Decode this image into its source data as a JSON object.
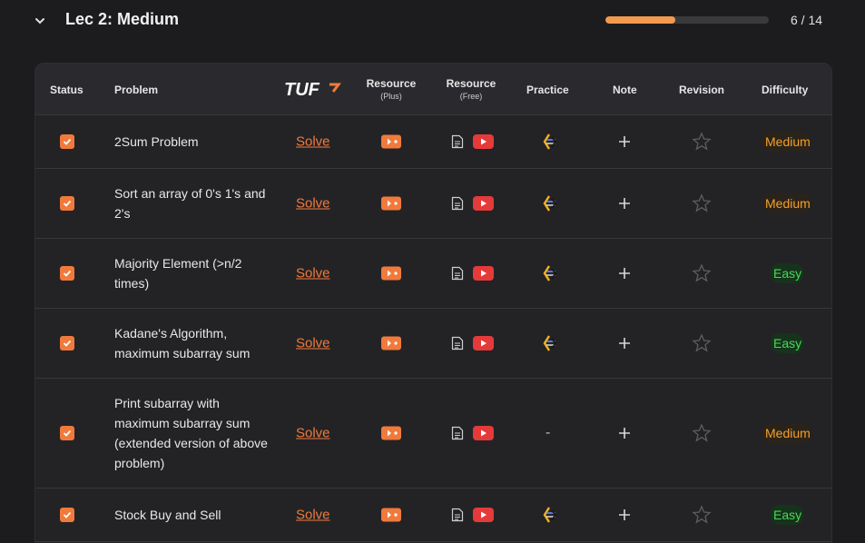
{
  "section": {
    "title": "Lec 2: Medium",
    "progress_text": "6 / 14",
    "progress_fraction": 0.43
  },
  "colors": {
    "accent": "#f07a3c",
    "background": "#1c1c1e",
    "easy": "#4ad85a",
    "medium": "#f4a02a",
    "youtube": "#e53a3a"
  },
  "table": {
    "headers": {
      "status": "Status",
      "problem": "Problem",
      "tuf_logo": "TUF",
      "resource_plus": "Resource",
      "resource_plus_sub": "(Plus)",
      "resource_free": "Resource",
      "resource_free_sub": "(Free)",
      "practice": "Practice",
      "note": "Note",
      "revision": "Revision",
      "difficulty": "Difficulty"
    },
    "rows": [
      {
        "problem": "2Sum Problem",
        "solve": "Solve",
        "practice": "codestudio-icon",
        "difficulty": "Medium",
        "checked": true
      },
      {
        "problem": "Sort an array of 0's 1's and 2's",
        "solve": "Solve",
        "practice": "codestudio-icon",
        "difficulty": "Medium",
        "checked": true
      },
      {
        "problem": "Majority Element (>n/2 times)",
        "solve": "Solve",
        "practice": "codestudio-icon",
        "difficulty": "Easy",
        "checked": true
      },
      {
        "problem": "Kadane's Algorithm, maximum subarray sum",
        "solve": "Solve",
        "practice": "codestudio-icon",
        "difficulty": "Easy",
        "checked": true
      },
      {
        "problem": "Print subarray with maximum subarray sum (extended version of above problem)",
        "solve": "Solve",
        "practice": "-",
        "difficulty": "Medium",
        "checked": true
      },
      {
        "problem": "Stock Buy and Sell",
        "solve": "Solve",
        "practice": "codestudio-icon",
        "difficulty": "Easy",
        "checked": true
      }
    ]
  }
}
